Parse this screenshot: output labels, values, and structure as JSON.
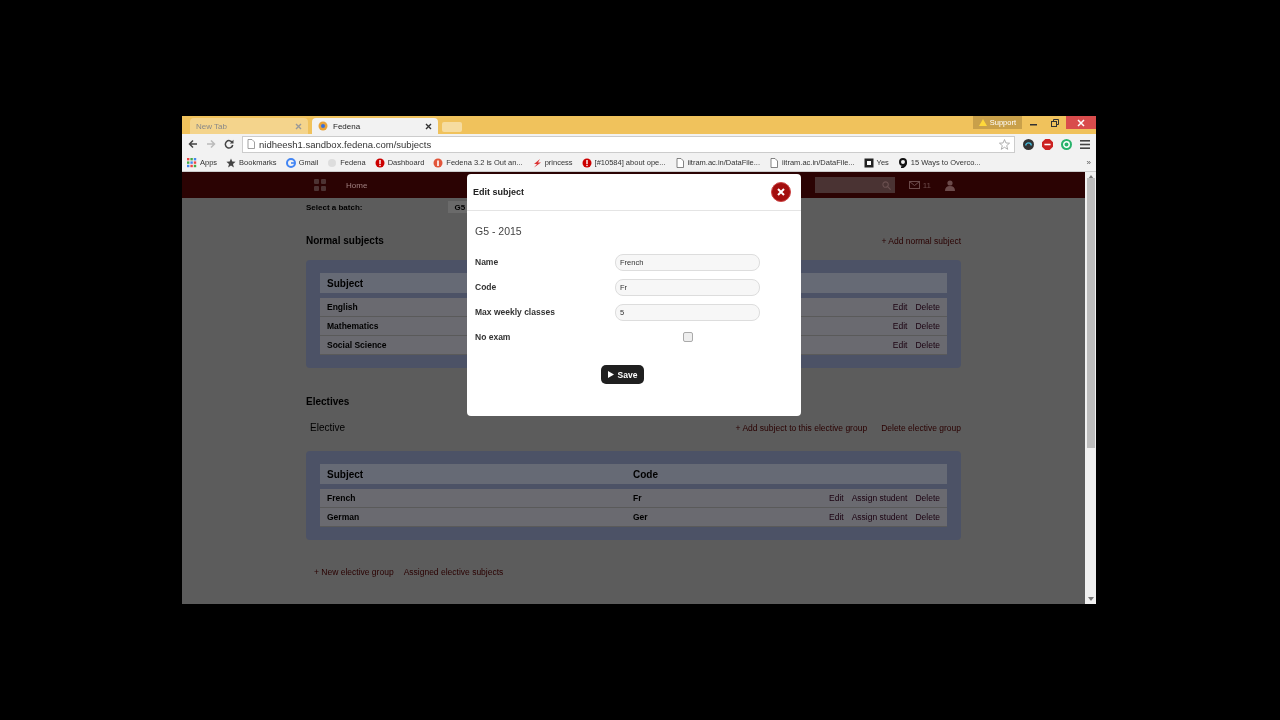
{
  "browser": {
    "tabs": [
      {
        "title": "New Tab",
        "selected": false
      },
      {
        "title": "Fedena",
        "selected": true
      }
    ],
    "support": "Support",
    "url": "nidheesh1.sandbox.fedena.com/subjects",
    "bookmarks": [
      {
        "label": "Apps",
        "kind": "grid"
      },
      {
        "label": "Bookmarks",
        "kind": "star"
      },
      {
        "label": "Gmail",
        "kind": "g"
      },
      {
        "label": "Fedena",
        "kind": "blank"
      },
      {
        "label": "Dashboard",
        "kind": "red"
      },
      {
        "label": "Fedena 3.2 is Out an...",
        "kind": "orange"
      },
      {
        "label": "princess",
        "kind": "bolt"
      },
      {
        "label": "[#10584] about ope...",
        "kind": "red"
      },
      {
        "label": "iitram.ac.in/DataFile...",
        "kind": "page"
      },
      {
        "label": "iitram.ac.in/DataFile...",
        "kind": "page"
      },
      {
        "label": "Yes",
        "kind": "square"
      },
      {
        "label": "15 Ways to Overco...",
        "kind": "swirl"
      }
    ],
    "more": "»"
  },
  "header": {
    "home": "Home",
    "mail_count": "11"
  },
  "batch": {
    "label": "Select a batch:",
    "value": "G5"
  },
  "normal": {
    "title": "Normal subjects",
    "add": "+ Add normal subject",
    "column": "Subject",
    "rows": [
      {
        "name": "English",
        "actions": [
          "Edit",
          "Delete"
        ]
      },
      {
        "name": "Mathematics",
        "actions": [
          "Edit",
          "Delete"
        ]
      },
      {
        "name": "Social Science",
        "actions": [
          "Edit",
          "Delete"
        ]
      }
    ]
  },
  "electives": {
    "title": "Electives",
    "group": "Elective",
    "add": "+ Add subject to this elective group",
    "delete": "Delete elective group",
    "columns": [
      "Subject",
      "Code"
    ],
    "rows": [
      {
        "name": "French",
        "code": "Fr",
        "actions": [
          "Edit",
          "Assign student",
          "Delete"
        ]
      },
      {
        "name": "German",
        "code": "Ger",
        "actions": [
          "Edit",
          "Assign student",
          "Delete"
        ]
      }
    ]
  },
  "footer_links": [
    "+ New elective group",
    "Assigned elective subjects"
  ],
  "dialog": {
    "title": "Edit subject",
    "batch": "G5 - 2015",
    "fields": [
      {
        "label": "Name",
        "kind": "text",
        "value": "French"
      },
      {
        "label": "Code",
        "kind": "text",
        "value": "Fr"
      },
      {
        "label": "Max weekly classes",
        "kind": "text",
        "value": "5"
      },
      {
        "label": "No exam",
        "kind": "checkbox",
        "checked": false
      }
    ],
    "save": "Save"
  }
}
